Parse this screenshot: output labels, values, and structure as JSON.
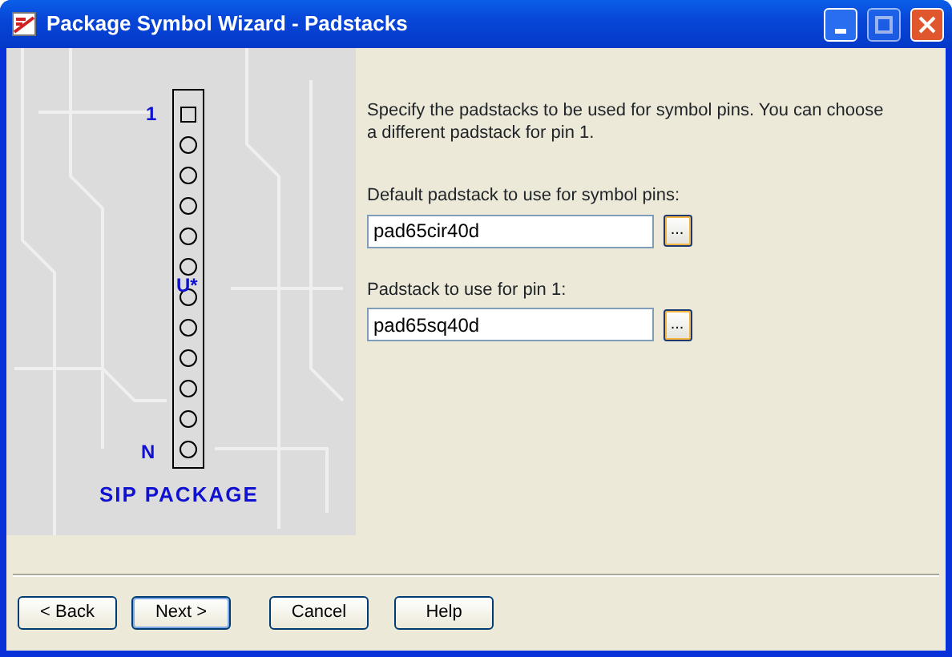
{
  "window": {
    "title": "Package Symbol Wizard - Padstacks"
  },
  "diagram": {
    "pin_first_label": "1",
    "ref_label": "U*",
    "pin_last_label": "N",
    "caption": "SIP PACKAGE"
  },
  "intro": "Specify the padstacks to be used for symbol pins. You can choose a different padstack for pin 1.",
  "fields": [
    {
      "label": "Default padstack to use for symbol pins:",
      "value": "pad65cir40d",
      "browse": "..."
    },
    {
      "label": "Padstack to use for pin 1:",
      "value": "pad65sq40d",
      "browse": "..."
    }
  ],
  "buttons": [
    {
      "label": "< Back",
      "default": false
    },
    {
      "label": "Next >",
      "default": true
    },
    {
      "label": "Cancel",
      "default": false
    },
    {
      "label": "Help",
      "default": false
    }
  ]
}
